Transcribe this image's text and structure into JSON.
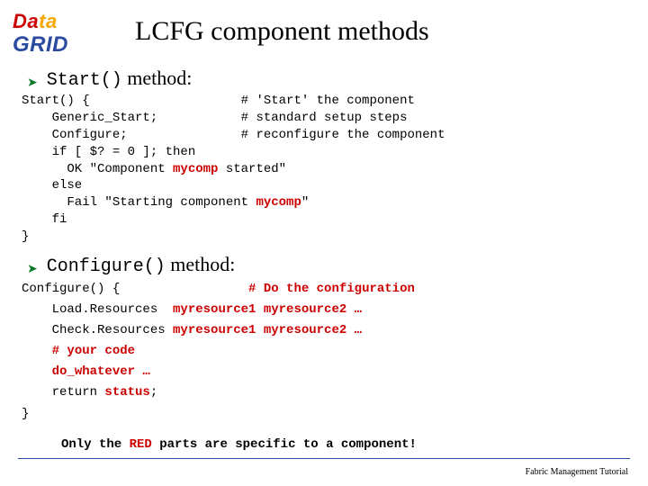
{
  "logo": {
    "data_a": "Da",
    "data_b": "ta",
    "grid": "GRID"
  },
  "title": "LCFG component methods",
  "bullet1": {
    "code": "Start()",
    "rest": " method:"
  },
  "code1": {
    "l1a": "Start() {                    # 'Start' the component",
    "l2a": "    Generic_Start;           # standard setup steps",
    "l3a": "    Configure;               # reconfigure the component",
    "l4a": "    if [ $? = 0 ]; then",
    "l5a": "      OK \"Component ",
    "l5b": "mycomp",
    "l5c": " started\"",
    "l6a": "    else",
    "l7a": "      Fail \"Starting component ",
    "l7b": "mycomp",
    "l7c": "\"",
    "l8a": "    fi",
    "l9a": "}"
  },
  "bullet2": {
    "code": "Configure()",
    "rest": " method:"
  },
  "code2": {
    "l1a": "Configure() {                 ",
    "l1b": "# Do the configuration",
    "l2a": "    Load.Resources  ",
    "l2b": "myresource1 myresource2 …",
    "l3a": "    Check.Resources ",
    "l3b": "myresource1 myresource2 …",
    "l4a": "    ",
    "l4b": "# your code",
    "l5a": "    ",
    "l5b": "do_whatever …",
    "l6a": "    return ",
    "l6b": "status",
    "l6c": ";",
    "l7a": "}"
  },
  "closing": {
    "a": "Only the ",
    "b": "RED",
    "c": " parts are specific to a component!"
  },
  "footer": "Fabric Management Tutorial"
}
